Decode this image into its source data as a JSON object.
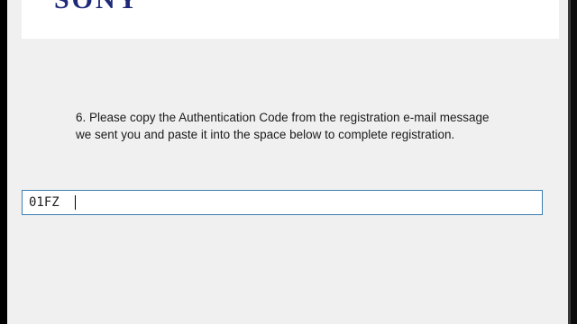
{
  "header": {
    "logo_text": "SONY"
  },
  "step": {
    "instruction_line1": "6. Please copy the Authentication Code from the registration e-mail message",
    "instruction_line2": "we sent you and paste it into the space below to complete registration."
  },
  "auth_code_input": {
    "value": "01FZ"
  },
  "colors": {
    "logo": "#1e2a78",
    "input_border": "#3c7fb1",
    "window_bg": "#f0f0f0"
  }
}
